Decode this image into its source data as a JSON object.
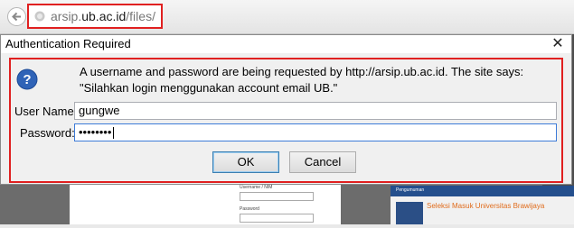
{
  "browser": {
    "url_prefix": "arsip.",
    "url_domain": "ub.ac.id",
    "url_path": "/files/"
  },
  "dialog": {
    "title": "Authentication Required",
    "message": "A username and password are being requested by http://arsip.ub.ac.id. The site says: \"Silahkan login menggunakan account email UB.\"",
    "username_label": "User Name:",
    "username_value": "gungwe",
    "password_label": "Password:",
    "password_value": "••••••••",
    "ok_label": "OK",
    "cancel_label": "Cancel"
  },
  "background_page": {
    "form_username_label": "Username / NIM",
    "form_password_label": "Password",
    "news_header": "Pengumuman",
    "news_title": "Seleksi Masuk Universitas Brawijaya"
  },
  "colors": {
    "highlight_border": "#e02020",
    "focus_border": "#3d7bd8"
  }
}
